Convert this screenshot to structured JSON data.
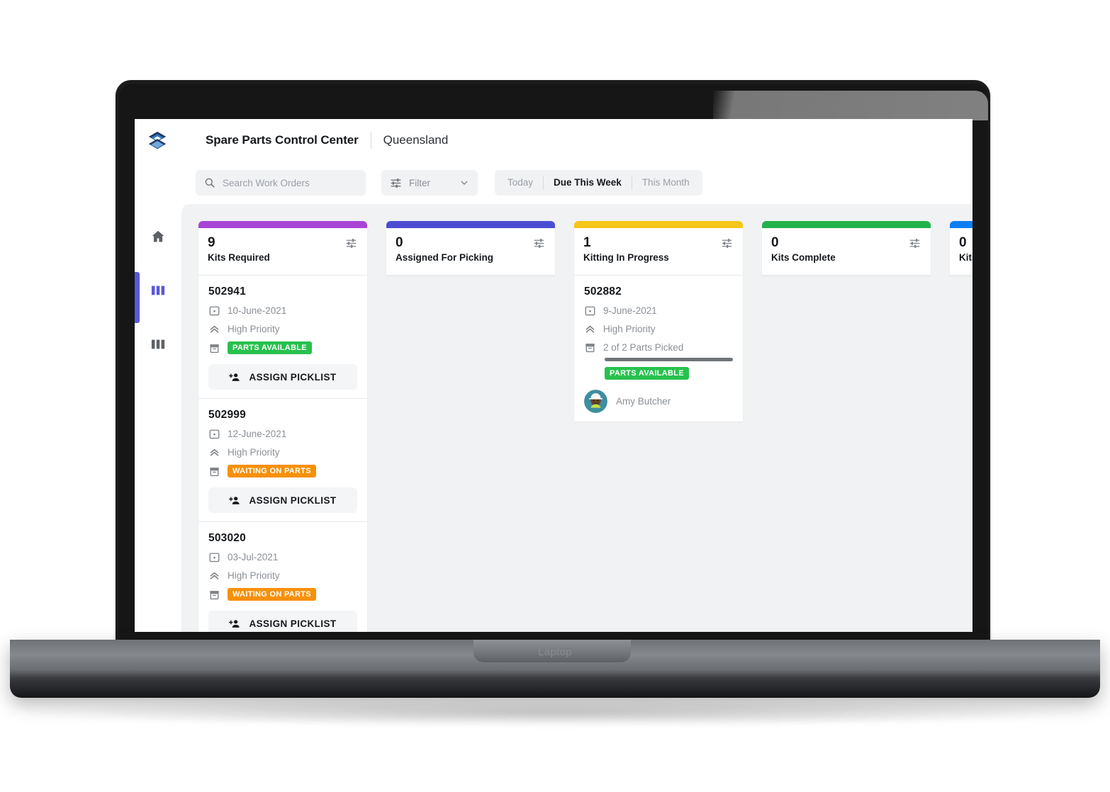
{
  "device": {
    "label": "Laptop"
  },
  "header": {
    "logo_icon": "hexagon-layers-logo",
    "title": "Spare Parts Control Center",
    "region": "Queensland"
  },
  "toolbar": {
    "search": {
      "icon": "search-icon",
      "placeholder": "Search Work Orders",
      "value": ""
    },
    "filter": {
      "icon": "tune-icon",
      "label": "Filter",
      "chevron_icon": "chevron-down-icon"
    },
    "date_range": {
      "options": [
        "Today",
        "Due This Week",
        "This Month"
      ],
      "selected": "Due This Week"
    }
  },
  "sidebar": {
    "items": [
      {
        "icon": "home-icon",
        "name": "home",
        "active": false
      },
      {
        "icon": "kanban-board-icon",
        "name": "board",
        "active": true
      },
      {
        "icon": "kanban-board-icon",
        "name": "board-alt",
        "active": false
      }
    ]
  },
  "board": {
    "columns": [
      {
        "count": "9",
        "title": "Kits Required",
        "accent": "#A945D6",
        "tune_icon": "tune-icon",
        "cards": [
          {
            "id": "502941",
            "date": "10-June-2021",
            "date_icon": "calendar-icon",
            "priority": "High Priority",
            "priority_icon": "double-chevron-up-icon",
            "parts_icon": "box-icon",
            "status": "PARTS AVAILABLE",
            "status_color": "#27C14D",
            "action": {
              "icon": "person-add-icon",
              "label": "ASSIGN PICKLIST"
            }
          },
          {
            "id": "502999",
            "date": "12-June-2021",
            "date_icon": "calendar-icon",
            "priority": "High Priority",
            "priority_icon": "double-chevron-up-icon",
            "parts_icon": "box-icon",
            "status": "WAITING ON PARTS",
            "status_color": "#F79009",
            "action": {
              "icon": "person-add-icon",
              "label": "ASSIGN PICKLIST"
            }
          },
          {
            "id": "503020",
            "date": "03-Jul-2021",
            "date_icon": "calendar-icon",
            "priority": "High Priority",
            "priority_icon": "double-chevron-up-icon",
            "parts_icon": "box-icon",
            "status": "WAITING ON PARTS",
            "status_color": "#F79009",
            "action": {
              "icon": "person-add-icon",
              "label": "ASSIGN PICKLIST"
            }
          }
        ]
      },
      {
        "count": "0",
        "title": "Assigned For Picking",
        "accent": "#4B4DD1",
        "tune_icon": "tune-icon",
        "cards": []
      },
      {
        "count": "1",
        "title": "Kitting In Progress",
        "accent": "#F5C518",
        "tune_icon": "tune-icon",
        "cards": [
          {
            "id": "502882",
            "date": "9-June-2021",
            "date_icon": "calendar-icon",
            "priority": "High Priority",
            "priority_icon": "double-chevron-up-icon",
            "parts_icon": "box-icon",
            "parts_progress_text": "2 of 2 Parts Picked",
            "parts_progress_percent": 100,
            "status": "PARTS AVAILABLE",
            "status_color": "#27C14D",
            "assignee": {
              "name": "Amy Butcher",
              "avatar_icon": "worker-avatar"
            }
          }
        ]
      },
      {
        "count": "0",
        "title": "Kits Complete",
        "accent": "#22B24C",
        "tune_icon": "tune-icon",
        "cards": []
      },
      {
        "count": "0",
        "title": "Kits Picked",
        "accent": "#0D7FF2",
        "tune_icon": "tune-icon",
        "cards": []
      }
    ]
  }
}
